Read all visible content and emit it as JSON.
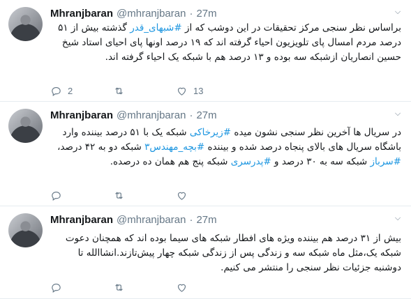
{
  "tweets": [
    {
      "name": "Mhranjbaran",
      "handle": "@mhranjbaran",
      "dot": "·",
      "time": "27m",
      "parts": [
        "براساس نظر سنجی مرکز تحقیقات در این دوشب که از ",
        "#شبهای_قدر",
        " گذشته بیش از ۵۱ درصد مردم امسال پای تلویزیون احیاء گرفته اند که ۱۹ درصد اونها پای احیای استاد شیخ حسین انصاریان ازشبکه سه بوده و ۱۳ درصد هم با شبکه یک احیاء گرفته اند."
      ],
      "replies": "2",
      "retweets": "",
      "likes": "13"
    },
    {
      "name": "Mhranjbaran",
      "handle": "@mhranjbaran",
      "dot": "·",
      "time": "27m",
      "parts": [
        "در سریال ها آخرین نظر سنجی نشون میده ",
        "#زیرخاکی",
        " شبکه یک با ۵۱ درصد بیننده وارد باشگاه سریال های بالای پنجاه درصد شده و بیننده ",
        "#بچه_مهندس۳",
        " شبکه دو به ۴۲ درصد، ",
        "#سرباز",
        " شبکه سه به ۳۰ درصد و ",
        "#پدرسری",
        " شبکه پنج هم همان ده درصده."
      ],
      "replies": "",
      "retweets": "",
      "likes": ""
    },
    {
      "name": "Mhranjbaran",
      "handle": "@mhranjbaran",
      "dot": "·",
      "time": "27m",
      "parts": [
        "بیش از ۳۱ درصد هم بیننده ویژه های افطار شبکه های سیما بوده اند که همچنان دعوت شبکه یک،مثل ماه شبکه سه و زندگی پس از زندگی شبکه چهار پیش‌تازند.انشاالله تا دوشنبه جزئیات نظر سنجی را منتشر می کنیم."
      ],
      "replies": "",
      "retweets": "",
      "likes": ""
    }
  ],
  "icons": {
    "reply": "reply-icon",
    "retweet": "retweet-icon",
    "like": "heart-icon",
    "caret": "chevron-down-icon"
  },
  "colors": {
    "hashtag": "#1b95e0",
    "muted": "#657786",
    "text": "#14171a",
    "divider": "#e6ecf0"
  }
}
